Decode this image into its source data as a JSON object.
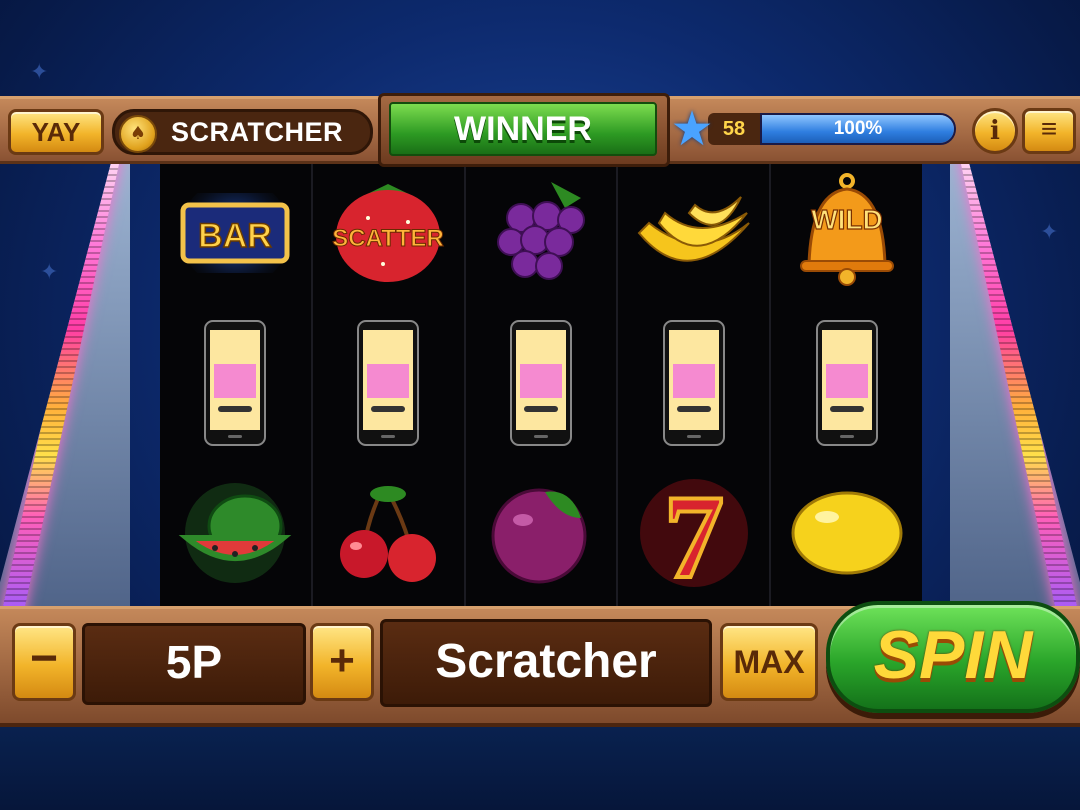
{
  "topbar": {
    "yay_label": "YAY",
    "scratcher_label": "SCRATCHER",
    "winner_label": "WINNER",
    "level": "58",
    "xp_percent_label": "100%",
    "xp_fraction": 1.0,
    "info_label": "i",
    "menu_label": "≡"
  },
  "reels": {
    "rows": [
      [
        "bar-symbol",
        "scatter-strawberry-symbol",
        "grapes-symbol",
        "banana-symbol",
        "wild-bell-symbol"
      ],
      [
        "phone-scratcher-symbol",
        "phone-scratcher-symbol",
        "phone-scratcher-symbol",
        "phone-scratcher-symbol",
        "phone-scratcher-symbol"
      ],
      [
        "watermelon-symbol",
        "cherries-symbol",
        "plum-symbol",
        "seven-symbol",
        "lemon-symbol"
      ]
    ],
    "symbol_text": {
      "bar": "BAR",
      "scatter": "SCATTER",
      "wild": "WILD",
      "seven": "7"
    }
  },
  "bottombar": {
    "minus_label": "−",
    "bet_value": "5P",
    "plus_label": "+",
    "game_name": "Scratcher",
    "max_label": "MAX",
    "spin_label": "SPIN"
  },
  "colors": {
    "wood": "#8a5233",
    "gold": "#f2b42a",
    "green": "#2d9a23",
    "background": "#0d2a6e"
  }
}
